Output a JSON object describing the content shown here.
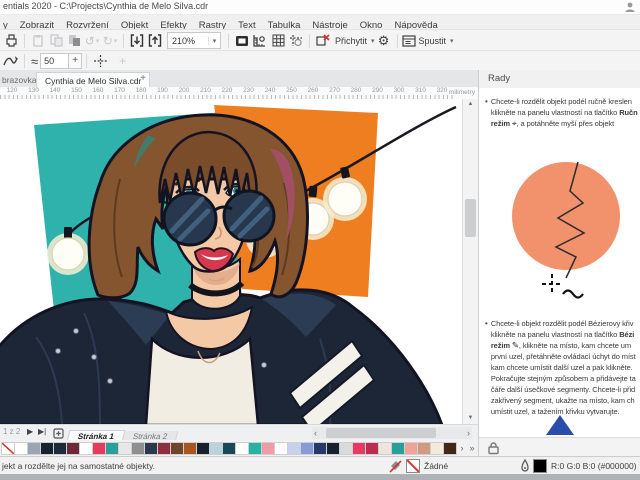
{
  "title_bar": {
    "title": "entials 2020 - C:\\Projects\\Cynthia de Melo Silva.cdr"
  },
  "menu": {
    "items": [
      "y",
      "Zobrazit",
      "Rozvržení",
      "Objekt",
      "Efekty",
      "Rastry",
      "Text",
      "Tabulka",
      "Nástroje",
      "Okno",
      "Nápověda"
    ]
  },
  "toolbar": {
    "zoom_value": "210%",
    "snap_label": "Přichytit",
    "launch_label": "Spustit"
  },
  "property_bar": {
    "smoothing_value": "50"
  },
  "doc_tabs": {
    "tabs": [
      {
        "label": "brazovka"
      },
      {
        "label": "Cynthia de Melo Silva.cdr"
      }
    ],
    "new_tab": "+"
  },
  "ruler": {
    "numbers": [
      120,
      130,
      140,
      150,
      160,
      170,
      180,
      190,
      200,
      210,
      220,
      230,
      240,
      250,
      260,
      270,
      280,
      290,
      300,
      310,
      320
    ],
    "unit": "milimetry"
  },
  "hints_panel": {
    "title": "Rady",
    "bullet1": [
      [
        {
          "t": "Chcete-li rozdělit objekt podél ručně kreslen"
        }
      ],
      [
        {
          "t": "klikněte na panelu vlastností na tlačítko "
        },
        {
          "t": "Ručn",
          "b": true
        }
      ],
      [
        {
          "t": "režim ",
          "b": true
        },
        {
          "t": "⌖",
          "icon": true
        },
        {
          "t": ", a potáhněte myší přes objekt"
        }
      ]
    ],
    "bullet2": [
      [
        {
          "t": "Chcete-li objekt rozdělit podél Bézierovy křiv"
        }
      ],
      [
        {
          "t": "klikněte na panelu vlastností na tlačítko "
        },
        {
          "t": "Bézi",
          "b": true
        }
      ],
      [
        {
          "t": "režim ",
          "b": true
        },
        {
          "t": "✎",
          "icon": true
        },
        {
          "t": ", klikněte na místo, kam chcete um"
        }
      ],
      [
        {
          "t": "první uzel, přetáhněte ovládací úchyt do míst"
        }
      ],
      [
        {
          "t": "kam chcete umístit další uzel a pak klikněte."
        }
      ],
      [
        {
          "t": "Pokračujte stejným způsobem a přidávejte ta"
        }
      ],
      [
        {
          "t": "čáře další úsečkové segmenty. Chcete-li přid"
        }
      ],
      [
        {
          "t": "zakřivený segment, ukažte na místo, kam ch"
        }
      ],
      [
        {
          "t": "umístit uzel, a tažením křivku vytvarujte."
        }
      ]
    ],
    "illustration_colors": {
      "circle": "#f2926c",
      "triangle": "#2b4fa8"
    }
  },
  "page_bar": {
    "position": "1 z 2",
    "tabs": [
      "Stránka 1",
      "Stránka 2"
    ]
  },
  "palette": {
    "colors": [
      "none",
      "#ffffff",
      "#9aa4b2",
      "#17222f",
      "#1d2b3c",
      "#6e2739",
      "#ffffff",
      "#e63a60",
      "#28a09a",
      "#e8e8e8",
      "#8f8f8f",
      "#2a3950",
      "#8f2e3e",
      "#6f462b",
      "#a95722",
      "#17222f",
      "#bad3db",
      "#184954",
      "#ffffff",
      "#28b2a6",
      "#f19ba5",
      "#ffffff",
      "#c8d0ed",
      "#8799d7",
      "#25396c",
      "#17222f",
      "#dadada",
      "#e63a60",
      "#ba2d4f",
      "#ece5dd",
      "#28a09a",
      "#f1a39b",
      "#d09c81",
      "#f3ead9",
      "#402918"
    ]
  },
  "status_bar": {
    "message": "jekt a rozdělte jej na samostatné objekty.",
    "fill_label": "Žádné",
    "outline_value": "R:0 G:0 B:0 (#000000)"
  },
  "canvas_colors": {
    "teal": "#2fb2ac",
    "orange": "#ef7e20",
    "hair": "#84552f",
    "hair_dark": "#5d3a1f",
    "hair_bangs": "#7a4c29",
    "hair_streak": "#a34f63",
    "skin": "#f4c9a6",
    "skin_shadow": "#dfa382",
    "jacket": "#1d2637",
    "jacket_light": "#2d3c55",
    "outline": "#141323",
    "shirt": "#f2ede2",
    "lips": "#d6394f",
    "lens": "#27374d",
    "lens_light": "#41607e",
    "bulb": "#fffef6",
    "glow": "#f6eed3",
    "wire": "#1a1a22",
    "stud": "#c3cad4",
    "eye": "#2e7f8c"
  },
  "icons": {
    "printer": "css-shape",
    "paste": "css-shape",
    "undo": "↺",
    "redo": "↻",
    "dropdown": "▾",
    "import": "css-shape",
    "export": "css-shape",
    "fullscreen_preview": "css-shape",
    "rulers": "css-shape",
    "grid": "css-shape",
    "guidelines": "css-shape",
    "snap_off": "css-shape",
    "gear": "⚙",
    "launcher": "css-shape",
    "freehand_smoothing": "css-shape",
    "wave": "≈",
    "crosshair": "css-shape",
    "plus": "+",
    "next_page": "▶",
    "last_page": "▶|",
    "add_page": "css-shape",
    "scroll_left": "‹",
    "scroll_right": "›",
    "palette_more": "»",
    "up": "▲",
    "down": "▼",
    "no_fill": "css-shape",
    "outline_pen": "css-shape",
    "lock": "css-shape",
    "user": "css-shape",
    "freehand_glyph": "⌖",
    "bezier_glyph": "✎"
  }
}
